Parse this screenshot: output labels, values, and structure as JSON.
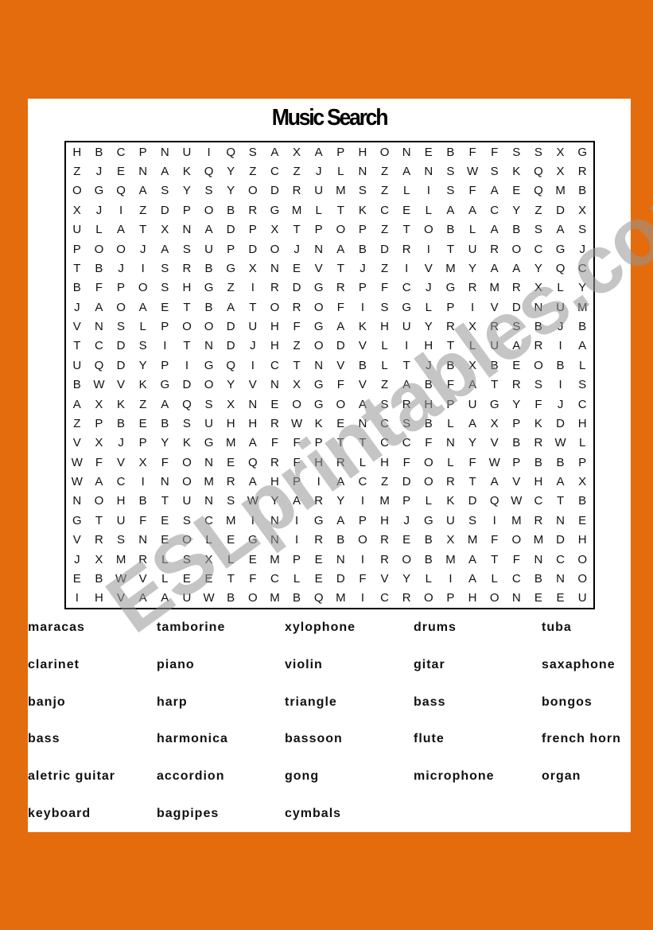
{
  "title": "Music Search",
  "watermark": "ESLprintables.com",
  "colors": {
    "background": "#E46C0C",
    "sheet": "#FFFFFF",
    "watermark": "#969696"
  },
  "grid": [
    "HBCPNUIQSAXAPHONEBFFSSXG",
    "ZJENAKQYZCZJLNZANSWSKQXR",
    "OGQASYSYODRUMSZLISFAEQMB",
    "XJIZDPOBRGMLTKCELAACYZDX",
    "ULATXNADPXTPOPZTOBLABSAS",
    "POOJASUPDOJNABDRITUROCGJ",
    "TBJISRBGXNEVTJZIVMYAAYQC",
    "BFPOSHGZIRDGRPFCJGRMRXLY",
    "JAOAETBATOROFISGLPIVDNUM",
    "VNSLPOODUHFGAKHUYRXRSBJB",
    "TCDSITNDJHZODVLIHTLUARIA",
    "UQDYPIGQICTNVBLTJBXBEOBL",
    "BWVKGDOYVNXGFVZABFATRSIS",
    "AXKZAQSXNEOGOASRHPUGYFJC",
    "ZPBEBSUHHRWKENCSBLAXPKDH",
    "VXJPYKGMAFFPTTCCFNYVBRWL",
    "WFVXFONEQRFHRLHFOLFWPBBP",
    "WACINOMRAHPIACZDORTAVHAX",
    "NOHBTUNSWYARYIMPLKDQWCTB",
    "GTUFESCMINIGAPHJGUSIMRNE",
    "VRSNEOLEGNIRBOREBXMFOMDH",
    "JXMRLSXLEMPENIROBMATFNCO",
    "EBWVLEETFCLEDFVYLIALCBNO",
    "IHVAAUWBOMBQMICROPHONEEU"
  ],
  "word_rows": [
    [
      "maracas",
      "tamborine",
      "xylophone",
      "drums",
      "tuba"
    ],
    [
      "clarinet",
      "piano",
      "violin",
      "gitar",
      "saxaphone"
    ],
    [
      "banjo",
      "harp",
      "triangle",
      "bass",
      "bongos"
    ],
    [
      "bass",
      "harmonica",
      "bassoon",
      "flute",
      "french horn"
    ],
    [
      "aletric guitar",
      "accordion",
      "gong",
      "microphone",
      "organ"
    ],
    [
      "keyboard",
      "bagpipes",
      "cymbals"
    ]
  ]
}
